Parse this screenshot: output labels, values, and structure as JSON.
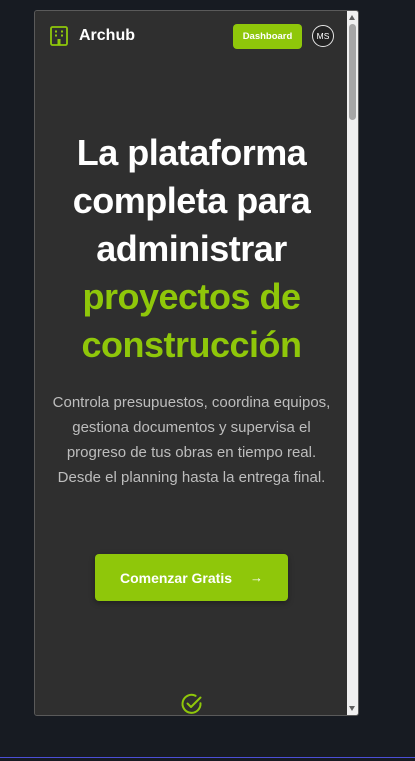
{
  "header": {
    "brand": "Archub",
    "dashboard_label": "Dashboard",
    "avatar_initials": "MS"
  },
  "hero": {
    "title_lines": [
      "La plataforma",
      "completa para",
      "administrar"
    ],
    "title_accent_lines": [
      "proyectos de",
      "construcción"
    ],
    "description": "Controla presupuestos, coordina equipos, gestiona documentos y supervisa el progreso de tus obras en tiempo real. Desde el planning hasta la entrega final.",
    "cta_label": "Comenzar Gratis",
    "cta_arrow": "→"
  },
  "icons": {
    "logo": "building-icon",
    "feature": "check-circle-icon"
  },
  "colors": {
    "accent": "#8fc70a",
    "panel": "#2f2f2f",
    "page_bg": "#171b22"
  }
}
